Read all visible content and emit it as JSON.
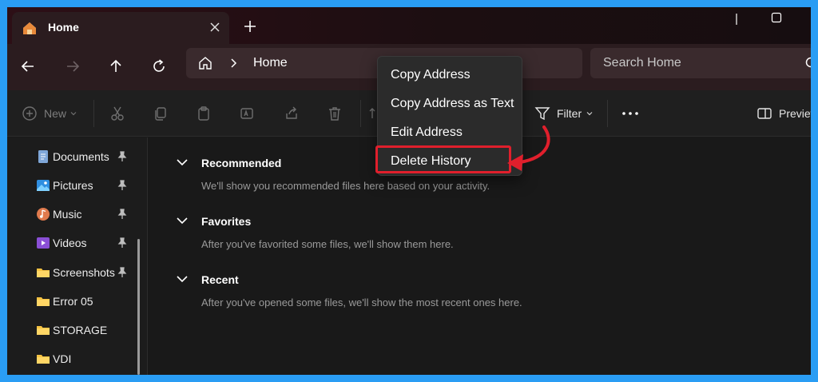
{
  "tab": {
    "title": "Home"
  },
  "address": {
    "path": "Home"
  },
  "search": {
    "placeholder": "Search Home"
  },
  "toolbar": {
    "new_label": "New",
    "filter_label": "Filter",
    "preview_label": "Preview"
  },
  "sidebar": {
    "items": [
      {
        "label": "Documents",
        "icon": "documents-icon",
        "pinned": true
      },
      {
        "label": "Pictures",
        "icon": "pictures-icon",
        "pinned": true
      },
      {
        "label": "Music",
        "icon": "music-icon",
        "pinned": true
      },
      {
        "label": "Videos",
        "icon": "videos-icon",
        "pinned": true
      },
      {
        "label": "Screenshots",
        "icon": "folder-icon",
        "pinned": true
      },
      {
        "label": "Error 05",
        "icon": "folder-icon",
        "pinned": false
      },
      {
        "label": "STORAGE",
        "icon": "folder-icon",
        "pinned": false
      },
      {
        "label": "VDI",
        "icon": "folder-icon",
        "pinned": false
      }
    ]
  },
  "main": {
    "sections": [
      {
        "title": "Recommended",
        "description": "We'll show you recommended files here based on your activity."
      },
      {
        "title": "Favorites",
        "description": "After you've favorited some files, we'll show them here."
      },
      {
        "title": "Recent",
        "description": "After you've opened some files, we'll show the most recent ones here."
      }
    ]
  },
  "context_menu": {
    "items": [
      "Copy Address",
      "Copy Address as Text",
      "Edit Address",
      "Delete History"
    ],
    "highlighted": "Delete History"
  },
  "colors": {
    "highlight_border": "#e01f2c",
    "frame": "#2a9df4",
    "folder": "#f5c242"
  }
}
